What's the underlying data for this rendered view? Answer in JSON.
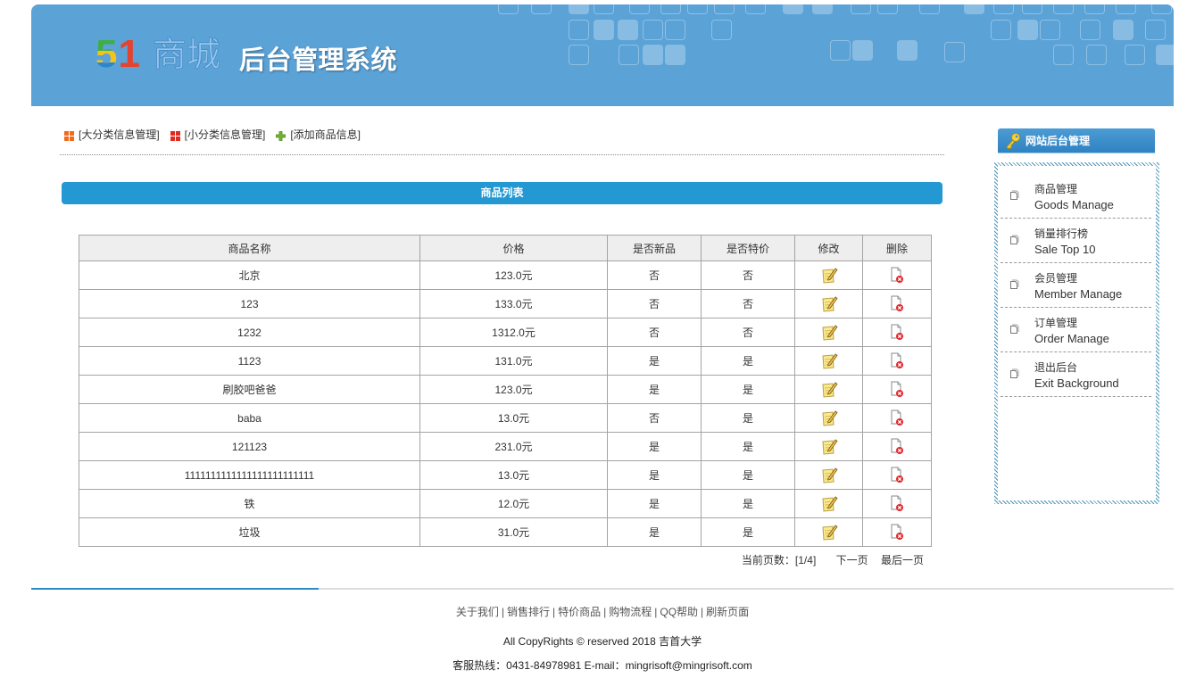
{
  "header": {
    "logo_digit_1": "5",
    "logo_digit_2": "1",
    "logo_text": "商城",
    "title": "后台管理系统"
  },
  "colors": {
    "banner": "#5ba2d7",
    "accent": "#2398d3",
    "sidebar_tab": "#2f83c2"
  },
  "top_links": [
    {
      "label": "[大分类信息管理]",
      "icon": "orange-grid-icon"
    },
    {
      "label": "[小分类信息管理]",
      "icon": "red-grid-icon"
    },
    {
      "label": "[添加商品信息]",
      "icon": "green-plus-icon"
    }
  ],
  "list_title": "商品列表",
  "table": {
    "headers": [
      "商品名称",
      "价格",
      "是否新品",
      "是否特价",
      "修改",
      "删除"
    ],
    "edit_icon": "edit-icon",
    "delete_icon": "delete-icon",
    "rows": [
      {
        "name": "北京",
        "price": "123.0元",
        "is_new": "否",
        "is_special": "否"
      },
      {
        "name": "123",
        "price": "133.0元",
        "is_new": "否",
        "is_special": "否"
      },
      {
        "name": "1232",
        "price": "1312.0元",
        "is_new": "否",
        "is_special": "否"
      },
      {
        "name": "1123",
        "price": "131.0元",
        "is_new": "是",
        "is_special": "是"
      },
      {
        "name": "刷胶吧爸爸",
        "price": "123.0元",
        "is_new": "是",
        "is_special": "是"
      },
      {
        "name": "baba",
        "price": "13.0元",
        "is_new": "否",
        "is_special": "是"
      },
      {
        "name": "121123",
        "price": "231.0元",
        "is_new": "是",
        "is_special": "是"
      },
      {
        "name": "1111111111111111111111111",
        "price": "13.0元",
        "is_new": "是",
        "is_special": "是"
      },
      {
        "name": "铁",
        "price": "12.0元",
        "is_new": "是",
        "is_special": "是"
      },
      {
        "name": "垃圾",
        "price": "31.0元",
        "is_new": "是",
        "is_special": "是"
      }
    ]
  },
  "pagination": {
    "current": "当前页数：[1/4]",
    "next": "下一页",
    "last": "最后一页"
  },
  "sidebar": {
    "title": "网站后台管理",
    "title_icon": "key-icon",
    "item_icon": "document-icon",
    "items": [
      {
        "cn": "商品管理",
        "en": "Goods Manage"
      },
      {
        "cn": "销量排行榜",
        "en": "Sale Top 10"
      },
      {
        "cn": "会员管理",
        "en": "Member Manage"
      },
      {
        "cn": "订单管理",
        "en": "Order Manage"
      },
      {
        "cn": "退出后台",
        "en": "Exit Background"
      }
    ]
  },
  "footer": {
    "links": [
      "关于我们",
      "销售排行",
      "特价商品",
      "购物流程",
      "QQ帮助",
      "刷新页面"
    ],
    "separator": "|",
    "copyright": "All CopyRights © reserved 2018 吉首大学",
    "contact": "客服热线：0431-84978981 E-mail：mingrisoft@mingrisoft.com"
  }
}
